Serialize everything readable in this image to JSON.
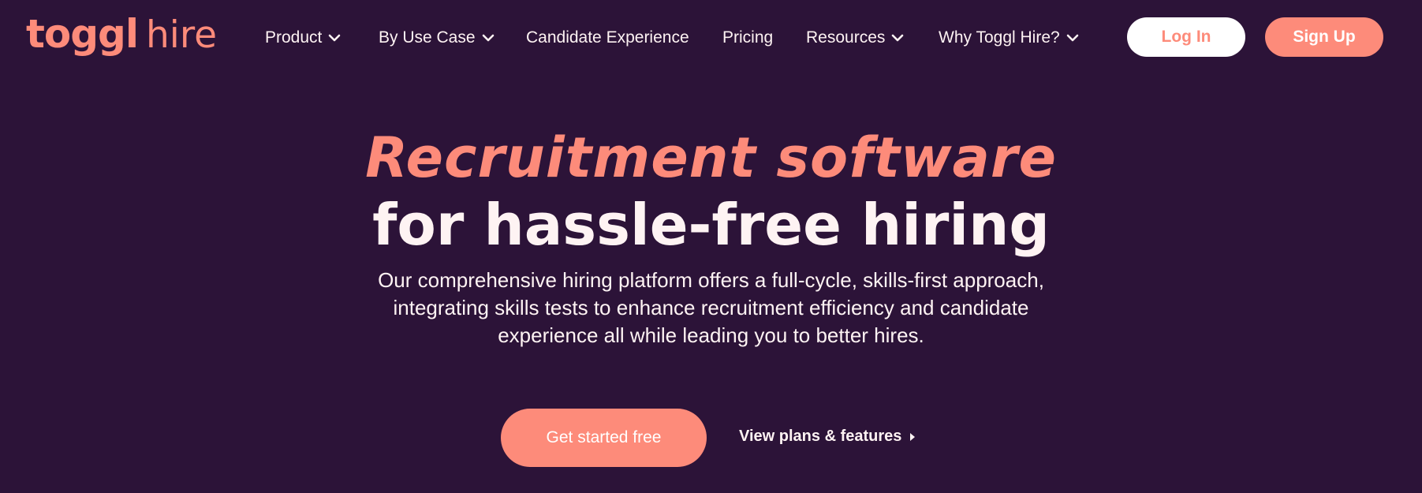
{
  "brand": {
    "logo_main": "toggl",
    "logo_sub": "hire",
    "accent": "#fd8b7a",
    "background": "#2c1338"
  },
  "nav": {
    "items": [
      {
        "label": "Product",
        "has_dropdown": true
      },
      {
        "label": "By Use Case",
        "has_dropdown": true
      },
      {
        "label": "Candidate Experience",
        "has_dropdown": false
      },
      {
        "label": "Pricing",
        "has_dropdown": false
      },
      {
        "label": "Resources",
        "has_dropdown": true
      },
      {
        "label": "Why Toggl Hire?",
        "has_dropdown": true
      }
    ]
  },
  "auth": {
    "login_label": "Log In",
    "signup_label": "Sign Up"
  },
  "hero": {
    "headline_line1": "Recruitment software",
    "headline_line2": "for hassle-free hiring",
    "subtitle": "Our comprehensive hiring platform offers a full-cycle, skills-first approach, integrating skills tests to enhance recruitment efficiency and candidate experience all while leading you to better hires.",
    "cta_primary": "Get started free",
    "cta_secondary": "View plans & features"
  },
  "icons": {
    "dropdown": "chevron-down-icon",
    "link_arrow": "caret-right-icon"
  }
}
